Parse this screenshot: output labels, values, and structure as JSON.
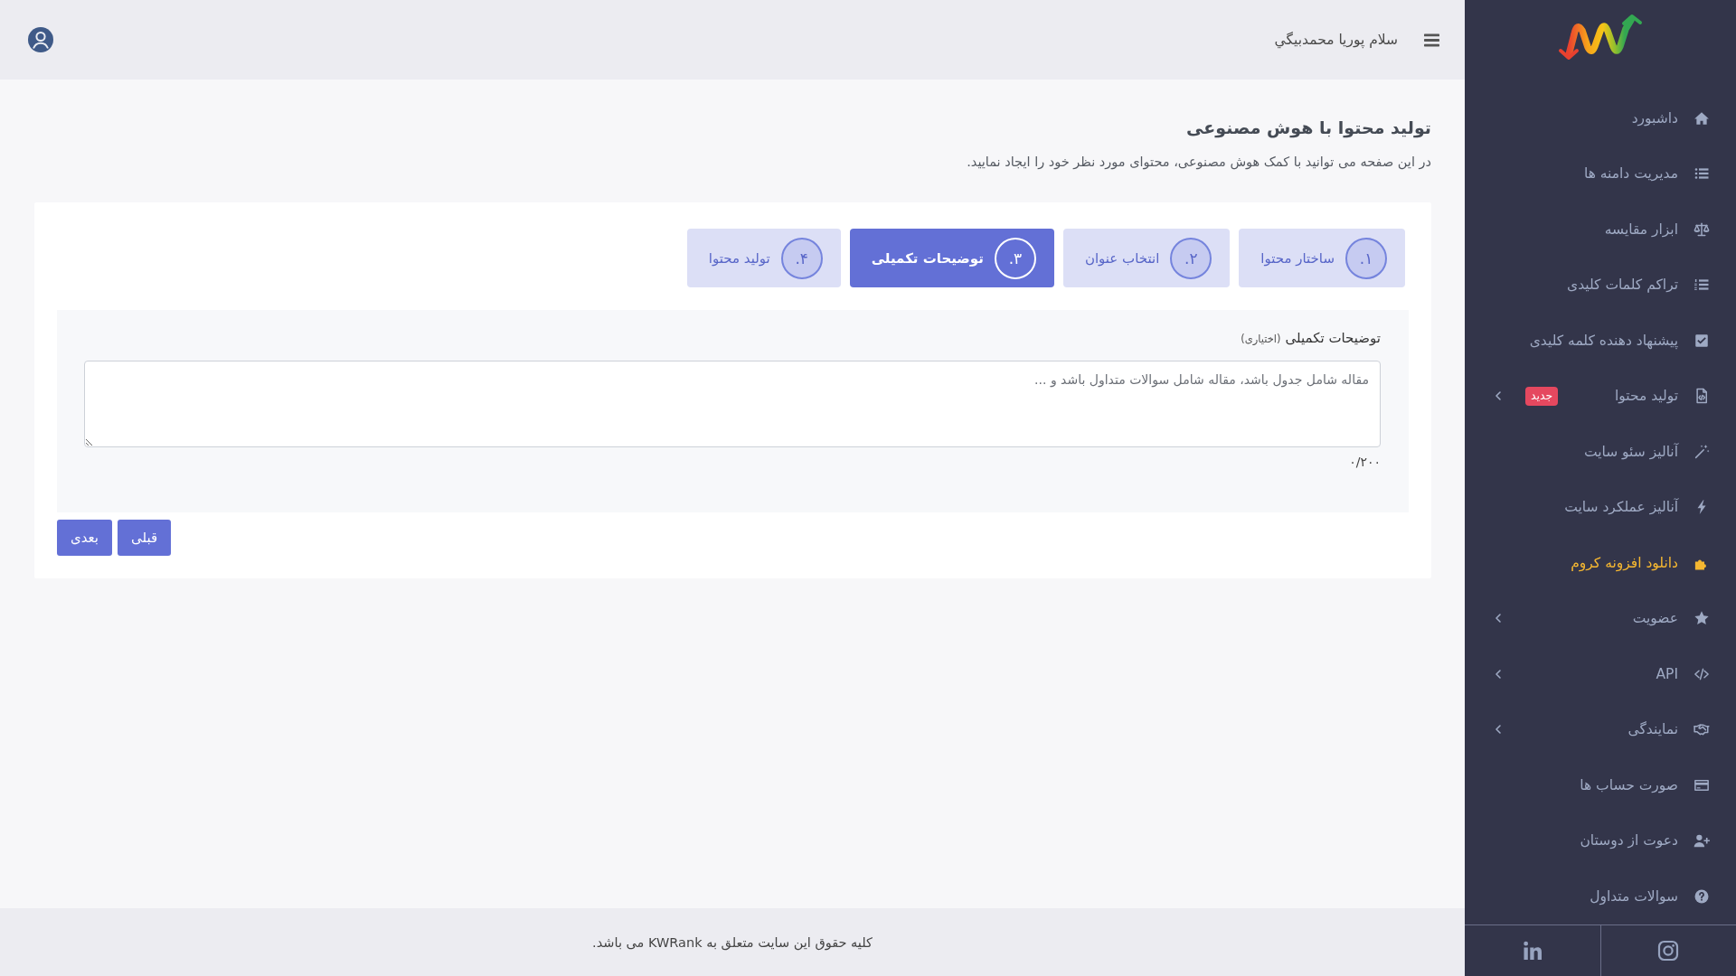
{
  "sidebar": {
    "items": [
      {
        "label": "داشبورد",
        "expandable": false,
        "highlighted": false
      },
      {
        "label": "مدیریت دامنه ها",
        "expandable": false,
        "highlighted": false
      },
      {
        "label": "ابزار مقایسه",
        "expandable": false,
        "highlighted": false
      },
      {
        "label": "تراکم کلمات کلیدی",
        "expandable": false,
        "highlighted": false
      },
      {
        "label": "پیشنهاد دهنده کلمه کلیدی",
        "expandable": false,
        "highlighted": false
      },
      {
        "label": "تولید محتوا",
        "badge": "جدید",
        "expandable": true,
        "highlighted": false
      },
      {
        "label": "آنالیز سئو سایت",
        "expandable": false,
        "highlighted": false
      },
      {
        "label": "آنالیز عملکرد سایت",
        "expandable": false,
        "highlighted": false
      },
      {
        "label": "دانلود افزونه کروم",
        "expandable": false,
        "highlighted": true
      },
      {
        "label": "عضویت",
        "expandable": true,
        "highlighted": false
      },
      {
        "label": "API",
        "expandable": true,
        "highlighted": false
      },
      {
        "label": "نمایندگی",
        "expandable": true,
        "highlighted": false
      },
      {
        "label": "صورت حساب ها",
        "expandable": false,
        "highlighted": false
      },
      {
        "label": "دعوت از دوستان",
        "expandable": false,
        "highlighted": false
      },
      {
        "label": "سوالات متداول",
        "expandable": false,
        "highlighted": false
      }
    ]
  },
  "header": {
    "greeting": "سلام پوریا محمدبیگي"
  },
  "page": {
    "title": "تولید محتوا با هوش مصنوعی",
    "subtitle": "در این صفحه می توانید با کمک هوش مصنوعی، محتوای مورد نظر خود را ایجاد نمایید."
  },
  "stepper": {
    "steps": [
      {
        "number": "۱.",
        "label": "ساختار محتوا",
        "selected": false
      },
      {
        "number": "۲.",
        "label": "انتخاب عنوان",
        "selected": false
      },
      {
        "number": "۳.",
        "label": "توضیحات تکمیلی",
        "selected": true
      },
      {
        "number": "۴.",
        "label": "تولید محتوا",
        "selected": false
      }
    ]
  },
  "form": {
    "label": "توضیحات تکمیلی",
    "optional_note": "(اختیاری)",
    "placeholder": "مقاله شامل جدول باشد، مقاله شامل سوالات متداول باشد و ...",
    "counter": "۰/۲۰۰"
  },
  "buttons": [
    {
      "label": "قبلی"
    },
    {
      "label": "بعدی"
    }
  ],
  "footer": {
    "text": "کلیه حقوق این سایت متعلق به KWRank می باشد."
  }
}
